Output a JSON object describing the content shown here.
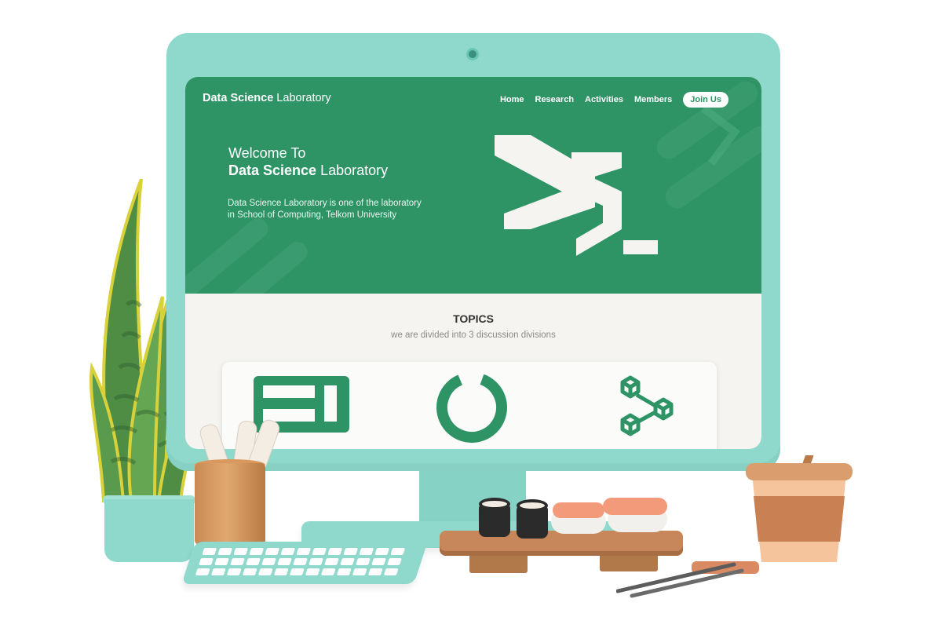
{
  "site": {
    "brand_bold": "Data Science",
    "brand_rest": " Laboratory",
    "nav": [
      "Home",
      "Research",
      "Activities",
      "Members"
    ],
    "join_label": "Join Us"
  },
  "hero": {
    "welcome": "Welcome To",
    "title_bold": "Data Science",
    "title_rest": " Laboratory",
    "subtitle_line1": "Data Science Laboratory is one of the laboratory",
    "subtitle_line2": "in School of Computing, Telkom University"
  },
  "topics": {
    "title": "TOPICS",
    "subtitle": "we are divided into 3 discussion divisions",
    "icons": [
      "dashboard-icon",
      "donut-chart-icon",
      "network-cubes-icon"
    ]
  },
  "colors": {
    "brand_green": "#2e9466",
    "monitor_mint": "#8fd9cc",
    "page_bg": "#f5f4f1"
  }
}
